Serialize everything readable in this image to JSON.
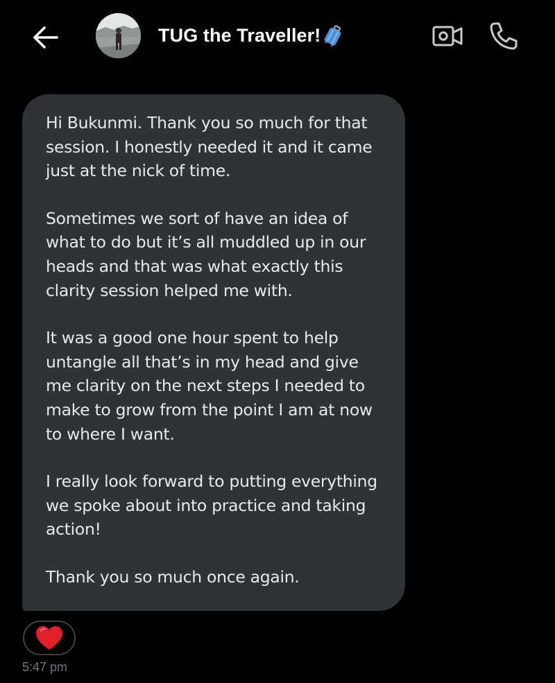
{
  "header": {
    "title": "TUG the Traveller!",
    "title_emoji": "luggage-icon",
    "back_icon": "arrow-left-icon",
    "video_icon": "video-camera-icon",
    "phone_icon": "phone-icon"
  },
  "message": {
    "paragraphs": [
      "Hi Bukunmi. Thank you so much for that session. I honestly needed it and it came just at the nick of time.",
      "Sometimes we sort of have an idea of what to do but it’s all muddled up in our heads and that was what exactly this clarity session helped me with.",
      "It was a good one hour spent to help untangle all that’s in my head and give me clarity on the next steps I needed to make to grow from the point I am at now to where I want.",
      "I really look forward to putting everything we spoke about into practice and taking action!",
      "Thank you so much once again."
    ],
    "reaction": "red-heart-icon",
    "timestamp": "5:47 pm"
  },
  "colors": {
    "background": "#000000",
    "bubble": "#2f3336",
    "text": "#e7e9ea",
    "muted": "#71767b",
    "heart": "#e0202b"
  }
}
